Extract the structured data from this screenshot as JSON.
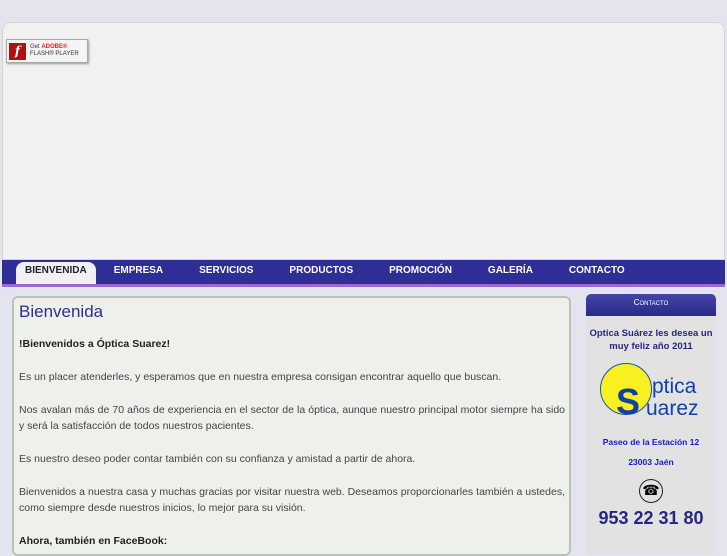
{
  "flash": {
    "line1": "Get",
    "brand": "ADOBE®",
    "line2": "FLASH® PLAYER"
  },
  "nav": [
    "BIENVENIDA",
    "EMPRESA",
    "SERVICIOS",
    "PRODUCTOS",
    "PROMOCIÓN",
    "GALERÍA",
    "CONTACTO"
  ],
  "main": {
    "title": "Bienvenida",
    "paragraphs": [
      "!Bienvenidos a Óptica Suarez!",
      "Es un placer atenderles, y esperamos que en nuestra empresa consigan encontrar aquello que buscan.",
      "Nos avalan más de 70 años de experiencia en el sector de la óptica, aunque nuestro principal motor siempre ha sido y será la satisfacción de todos nuestros pacientes.",
      "Es nuestro deseo poder contar también con su confianza y amistad a partir de ahora.",
      "Bienvenidos a nuestra casa y muchas gracias por visitar nuestra web. Deseamos proporcionarles también a ustedes, como siempre desde nuestros inicios, lo mejor para su visión.",
      "Ahora, también en FaceBook:"
    ]
  },
  "side": {
    "header": "Contacto",
    "greeting": "Optica Suárez les desea un muy feliz año 2011",
    "logo_text1": "ptica",
    "logo_text2": "uarez",
    "address": "Paseo de la Estación 12",
    "city": "23003 Jaén",
    "phone": "953 22 31 80"
  }
}
